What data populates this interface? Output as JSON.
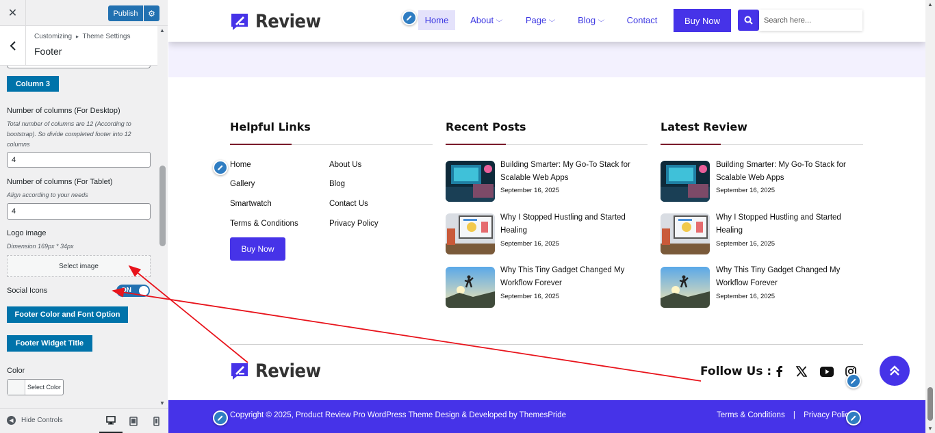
{
  "customizer": {
    "close_icon": "close-icon",
    "publish_label": "Publish",
    "settings_icon": "gear-icon",
    "breadcrumb": {
      "root": "Customizing",
      "separator": "▸",
      "parent": "Theme Settings"
    },
    "section_title": "Footer",
    "column3_button": "Column 3",
    "desktop_columns": {
      "label": "Number of columns (For Desktop)",
      "description": "Total number of columns are 12 (According to bootstrap). So divide completed footer into 12 columns",
      "value": "4"
    },
    "tablet_columns": {
      "label": "Number of columns (For Tablet)",
      "description": "Align according to your needs",
      "value": "4"
    },
    "logo_image": {
      "label": "Logo image",
      "description": "Dimension 169px * 34px",
      "button": "Select image"
    },
    "social_icons": {
      "label": "Social Icons",
      "toggle_text": "ON",
      "enabled": true
    },
    "footer_color_button": "Footer Color and Font Option",
    "footer_widget_title_button": "Footer Widget Title",
    "color": {
      "label": "Color",
      "button": "Select Color"
    },
    "hide_controls": "Hide Controls",
    "devices": [
      "desktop-icon",
      "tablet-icon",
      "mobile-icon"
    ],
    "active_device": "desktop"
  },
  "site": {
    "logo_text": "Review",
    "nav": [
      {
        "label": "Home",
        "active": true,
        "dropdown": false
      },
      {
        "label": "About",
        "active": false,
        "dropdown": true
      },
      {
        "label": "Page",
        "active": false,
        "dropdown": true
      },
      {
        "label": "Blog",
        "active": false,
        "dropdown": true
      },
      {
        "label": "Contact",
        "active": false,
        "dropdown": false
      }
    ],
    "buy_now": "Buy Now",
    "search_placeholder": "Search here...",
    "accent_color": "#4633e8"
  },
  "footer": {
    "helpful_links": {
      "title": "Helpful Links",
      "left": [
        "Home",
        "Gallery",
        "Smartwatch",
        "Terms & Conditions"
      ],
      "right": [
        "About Us",
        "Blog",
        "Contact Us",
        "Privacy Policy"
      ],
      "button": "Buy Now"
    },
    "recent_posts": {
      "title": "Recent Posts",
      "posts": [
        {
          "title": "Building Smarter: My Go-To Stack for Scalable Web Apps",
          "date": "September 16, 2025"
        },
        {
          "title": "Why I Stopped Hustling and Started Healing",
          "date": "September 16, 2025"
        },
        {
          "title": "Why This Tiny Gadget Changed My Workflow Forever",
          "date": "September 16, 2025"
        }
      ]
    },
    "latest_review": {
      "title": "Latest Review",
      "posts": [
        {
          "title": "Building Smarter: My Go-To Stack for Scalable Web Apps",
          "date": "September 16, 2025"
        },
        {
          "title": "Why I Stopped Hustling and Started Healing",
          "date": "September 16, 2025"
        },
        {
          "title": "Why This Tiny Gadget Changed My Workflow Forever",
          "date": "September 16, 2025"
        }
      ]
    },
    "follow_us": "Follow Us :",
    "social_icons": [
      "facebook-icon",
      "x-twitter-icon",
      "youtube-icon",
      "instagram-icon"
    ],
    "copyright": "Copyright © 2025, Product Review Pro WordPress Theme Design & Developed by ThemesPride",
    "bottom_links": [
      "Terms & Conditions",
      "Privacy Policy"
    ],
    "bottom_link_separator": "|"
  },
  "annotation": {
    "color": "#e8141c"
  }
}
